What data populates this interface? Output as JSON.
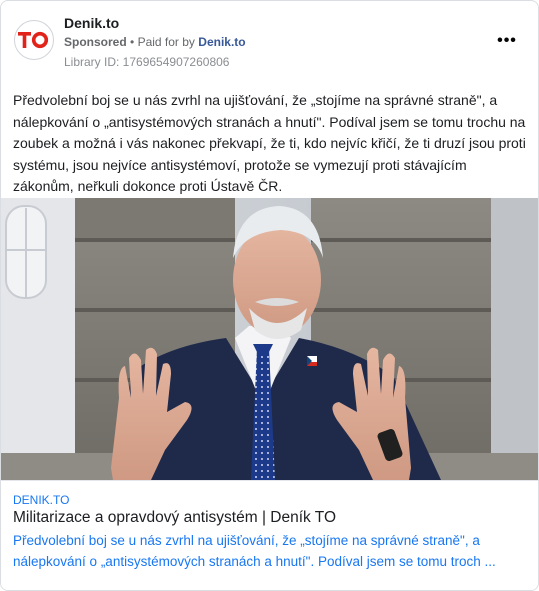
{
  "page": {
    "name": "Denik.to",
    "logo_text": "TO",
    "sponsored_label": "Sponsored",
    "separator": "•",
    "paid_for_label": "Paid for by",
    "paid_for_name": "Denik.to",
    "library_id": "Library ID: 1769654907260806",
    "more_label": "•••"
  },
  "post": {
    "body_text": "Předvolební boj se u nás zvrhl na ujišťování, že „stojíme na správné straně\", a nálepkování o „antisystémových stranách a hnutí\". Podíval jsem se tomu trochu na zoubek a možná i vás nakonec překvapí, že ti, kdo nejvíc křičí, že ti druzí jsou proti systému, jsou nejvíce antisystémoví, protože se vymezují proti stávajícím zákonům, neřkuli dokonce proti Ústavě ČR."
  },
  "link_preview": {
    "domain": "DENIK.TO",
    "title": "Militarizace a opravdový antisystém | Deník TO",
    "description": "Předvolební boj se u nás zvrhl na ujišťování, že „stojíme na správné straně\", a nálepkování o „antisystémových stranách a hnutí\". Podíval jsem se tomu troch ..."
  },
  "colors": {
    "brand_red": "#e2231a",
    "link_blue": "#1877f2",
    "suit_navy": "#1f2a4a"
  }
}
